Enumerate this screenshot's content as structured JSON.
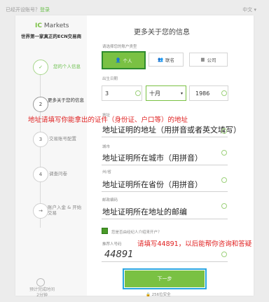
{
  "top_bar": {
    "left_prefix": "已经开设账号？",
    "login_link": "登录",
    "language": "中文"
  },
  "brand": {
    "logo_mark": "IC",
    "logo_text": "Markets",
    "slogan": "世界第一家真正的ECN交易商"
  },
  "steps": [
    {
      "marker": "✓",
      "label": "您的个人信息"
    },
    {
      "marker": "2",
      "label": "更多关于您的信息"
    },
    {
      "marker": "3",
      "label": "交易账号配置"
    },
    {
      "marker": "4",
      "label": "调查问卷"
    },
    {
      "marker": "→",
      "label": "账户入金 & 开始交易"
    }
  ],
  "time_estimate": {
    "label": "预计完成时间",
    "value": "2分钟"
  },
  "form": {
    "heading": "更多关于您的信息",
    "account_type_label": "请选择您的账户类型",
    "account_types": [
      "个人",
      "联名",
      "公司"
    ],
    "dob_label": "出生日期",
    "dob": {
      "day": "3",
      "month": "十月",
      "year": "1986"
    },
    "address_label": "地址",
    "address_value": "地址证明的地址（用拼音或者英文填写）",
    "city_label": "城市",
    "city_value": "地址证明所在城市（用拼音）",
    "province_label": "州/省",
    "province_value": "地址证明所在省份（用拼音）",
    "postcode_label": "邮政编码",
    "postcode_value": "地址证明所在地址的邮编",
    "referral_checkbox_label": "您是否由经纪人介绍来开户？",
    "referral_label": "推荐人号码",
    "referral_value": "44891",
    "next_button": "下一步",
    "secure_note": "🔒 256位安全"
  },
  "annotations": {
    "address_note": "地址请填写你能拿出的证件（身份证、户口等）的地址",
    "referral_note": "请填写44891，以后能帮你咨询和答疑"
  },
  "colors": {
    "accent_green": "#7ac143",
    "annotation_red": "#e02020",
    "button_outline_blue": "#2aa6e0"
  }
}
